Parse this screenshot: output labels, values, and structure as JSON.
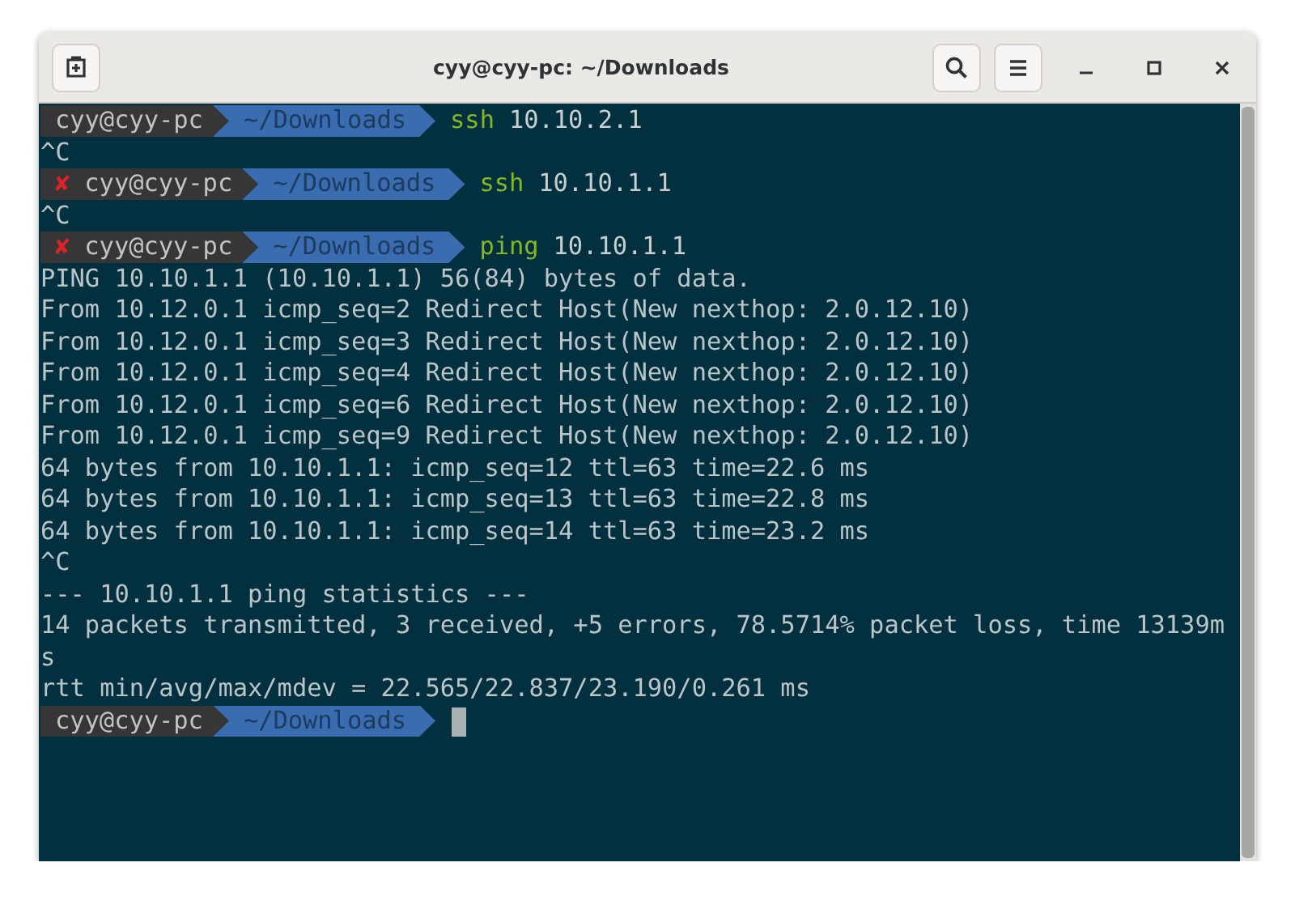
{
  "window": {
    "title": "cyy@cyy-pc: ~/Downloads"
  },
  "terminal": {
    "lines": [
      {
        "kind": "prompt",
        "user": "cyy@cyy-pc",
        "directory": "~/Downloads",
        "command": "ssh",
        "arguments": "10.10.2.1",
        "cursor": false
      },
      {
        "kind": "output",
        "text": "^C"
      },
      {
        "kind": "prompt",
        "status_mark": "✘",
        "user": "cyy@cyy-pc",
        "directory": "~/Downloads",
        "command": "ssh",
        "arguments": "10.10.1.1",
        "cursor": false
      },
      {
        "kind": "output",
        "text": "^C"
      },
      {
        "kind": "prompt",
        "status_mark": "✘",
        "user": "cyy@cyy-pc",
        "directory": "~/Downloads",
        "command": "ping",
        "arguments": "10.10.1.1",
        "cursor": false
      },
      {
        "kind": "output",
        "text": "PING 10.10.1.1 (10.10.1.1) 56(84) bytes of data."
      },
      {
        "kind": "output",
        "text": "From 10.12.0.1 icmp_seq=2 Redirect Host(New nexthop: 2.0.12.10)"
      },
      {
        "kind": "output",
        "text": "From 10.12.0.1 icmp_seq=3 Redirect Host(New nexthop: 2.0.12.10)"
      },
      {
        "kind": "output",
        "text": "From 10.12.0.1 icmp_seq=4 Redirect Host(New nexthop: 2.0.12.10)"
      },
      {
        "kind": "output",
        "text": "From 10.12.0.1 icmp_seq=6 Redirect Host(New nexthop: 2.0.12.10)"
      },
      {
        "kind": "output",
        "text": "From 10.12.0.1 icmp_seq=9 Redirect Host(New nexthop: 2.0.12.10)"
      },
      {
        "kind": "output",
        "text": "64 bytes from 10.10.1.1: icmp_seq=12 ttl=63 time=22.6 ms"
      },
      {
        "kind": "output",
        "text": "64 bytes from 10.10.1.1: icmp_seq=13 ttl=63 time=22.8 ms"
      },
      {
        "kind": "output",
        "text": "64 bytes from 10.10.1.1: icmp_seq=14 ttl=63 time=23.2 ms"
      },
      {
        "kind": "output",
        "text": "^C"
      },
      {
        "kind": "output",
        "text": "--- 10.10.1.1 ping statistics ---"
      },
      {
        "kind": "output",
        "text": "14 packets transmitted, 3 received, +5 errors, 78.5714% packet loss, time 13139m"
      },
      {
        "kind": "output",
        "text": "s"
      },
      {
        "kind": "output",
        "text": "rtt min/avg/max/mdev = 22.565/22.837/23.190/0.261 ms"
      },
      {
        "kind": "prompt",
        "user": "cyy@cyy-pc",
        "directory": "~/Downloads",
        "cursor": true
      }
    ]
  }
}
